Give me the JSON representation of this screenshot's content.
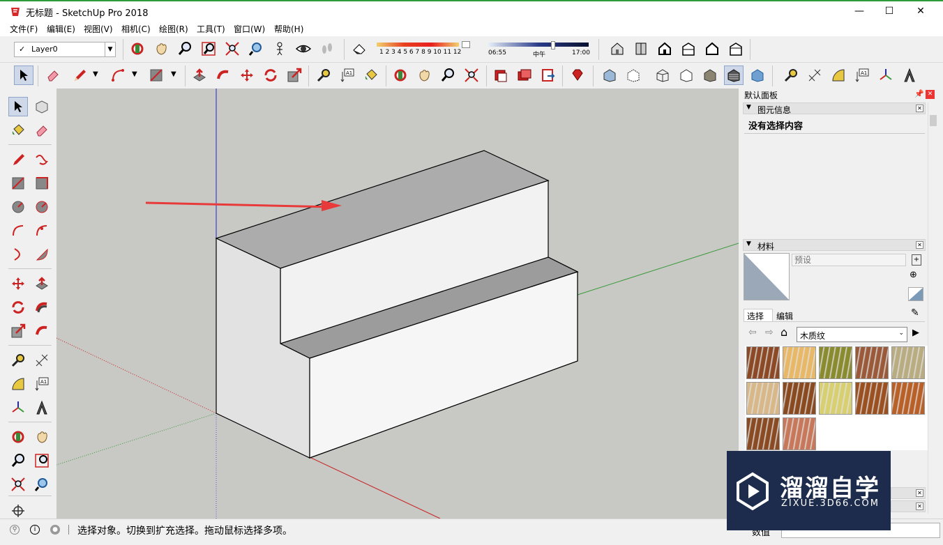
{
  "window": {
    "title": "无标题 - SketchUp Pro 2018",
    "minimize": "—",
    "maximize": "☐",
    "close": "✕"
  },
  "menu": [
    "文件(F)",
    "编辑(E)",
    "视图(V)",
    "相机(C)",
    "绘图(R)",
    "工具(T)",
    "窗口(W)",
    "帮助(H)"
  ],
  "layer": {
    "value": "Layer0",
    "check": "✓"
  },
  "shadow": {
    "months": "1 2 3 4 5 6 7 8 9 10 11 12",
    "time_start": "06:55",
    "time_mid": "中午",
    "time_end": "17:00"
  },
  "panel": {
    "title": "默认面板",
    "entity_info": {
      "header": "图元信息",
      "content": "没有选择内容"
    },
    "materials": {
      "header": "材料",
      "name_placeholder": "预设",
      "tab_select": "选择",
      "tab_edit": "编辑",
      "library": "木质纹",
      "swatch_colors": [
        "#8b4a25",
        "#e8b866",
        "#8a8a2e",
        "#9a5a3a",
        "#b8ac80",
        "#d8b888",
        "#8a4a20",
        "#d8d070",
        "#9a5020",
        "#b86028",
        "#8a4a22",
        "#c8785a"
      ]
    }
  },
  "status": {
    "text": "选择对象。切换到扩充选择。拖动鼠标选择多项。",
    "measure_label": "数值"
  },
  "watermark": {
    "brand": "溜溜自学",
    "url": "ZIXUE.3D66.COM"
  },
  "colors": {
    "titlebar_accent": "#2e9b3b",
    "annotation_arrow": "#e83a3a",
    "axis_blue": "#2323c8",
    "axis_green": "#3a9a3a",
    "axis_red": "#c82020"
  }
}
